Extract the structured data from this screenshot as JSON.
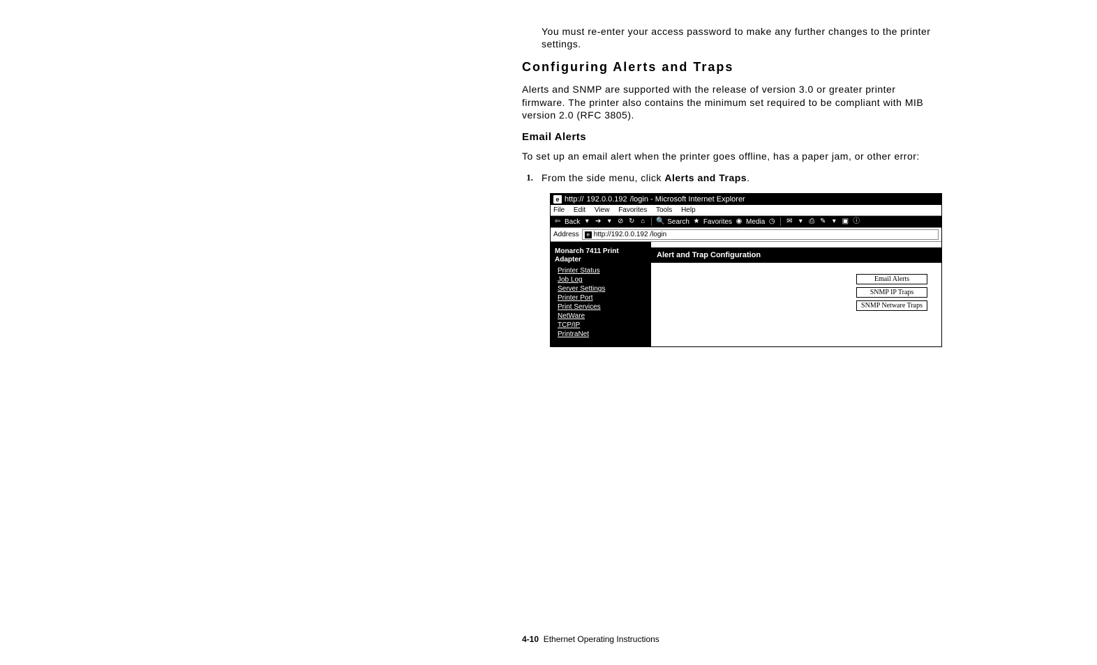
{
  "body": {
    "note": "You must re-enter your access password to make any further changes to the printer settings.",
    "section_title": "Configuring Alerts and Traps",
    "section_para": "Alerts and SNMP are supported with the release of version 3.0 or greater printer firmware. The printer also contains the minimum set required to be compliant with MIB version 2.0 (RFC 3805).",
    "sub_title": "Email Alerts",
    "sub_para": "To set up an email alert when the printer goes offline, has a paper jam, or other error:",
    "step1_num": "1.",
    "step1_pre": "From the side menu, click ",
    "step1_bold": "Alerts and Traps",
    "step1_post": "."
  },
  "ie": {
    "title_prefix": "http:// ",
    "title_host": "192.0.0.192",
    "title_suffix": " /login - Microsoft Internet Explorer",
    "menu": {
      "file": "File",
      "edit": "Edit",
      "view": "View",
      "favorites": "Favorites",
      "tools": "Tools",
      "help": "Help"
    },
    "toolbar": {
      "back": "Back",
      "search": "Search",
      "favorites": "Favorites",
      "media": "Media"
    },
    "address_label": "Address",
    "address_value": "http://192.0.0.192 /login",
    "sidebar": {
      "device": "Monarch 7411 Print Adapter",
      "links": [
        "Printer Status",
        "Job Log",
        "Server Settings",
        "Printer Port",
        "Print Services",
        "NetWare",
        "TCP/IP",
        "PrintraNet"
      ]
    },
    "pane_title": "Alert and Trap Configuration",
    "buttons": [
      "Email Alerts",
      "SNMP IP Traps",
      "SNMP Netware Traps"
    ]
  },
  "footer": {
    "page": "4-10",
    "doc": "Ethernet Operating Instructions"
  }
}
